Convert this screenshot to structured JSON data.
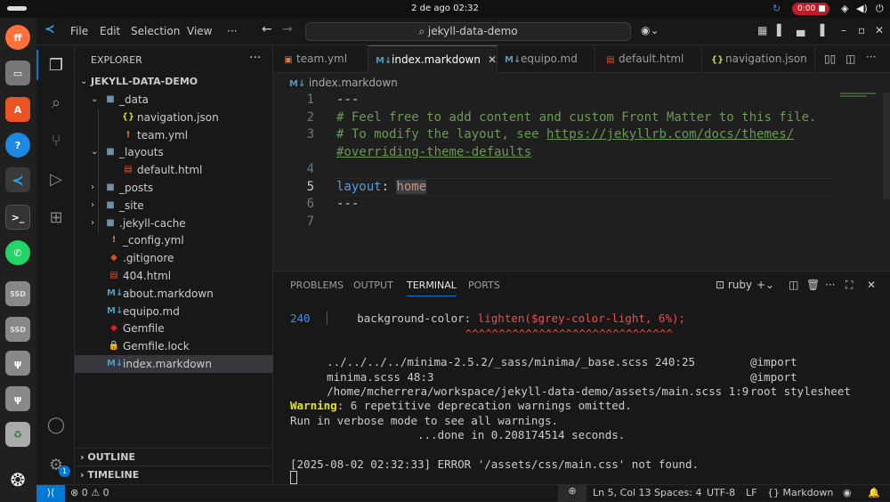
{
  "system": {
    "clock": "2 de ago  02:32",
    "recording": "0:00"
  },
  "dock": {
    "apps": [
      "firefox-icon",
      "files-icon",
      "app-center-icon",
      "help-icon",
      "vscode-icon",
      "terminal-icon",
      "whatsapp-icon",
      "drive-icon",
      "drive-icon",
      "usb-icon",
      "usb-icon",
      "trash-icon",
      "show-apps-icon"
    ],
    "ssd_label": "SSD"
  },
  "titlebar": {
    "menus": [
      "File",
      "Edit",
      "Selection",
      "View",
      "···"
    ],
    "search": "jekyll-data-demo"
  },
  "sidebar": {
    "title": "EXPLORER",
    "root": "JEKYLL-DATA-DEMO",
    "items": [
      {
        "label": "_data",
        "type": "folder",
        "open": true,
        "depth": 1
      },
      {
        "label": "navigation.json",
        "type": "json",
        "depth": 2
      },
      {
        "label": "team.yml",
        "type": "yml",
        "depth": 2
      },
      {
        "label": "_layouts",
        "type": "folder",
        "open": true,
        "depth": 1
      },
      {
        "label": "default.html",
        "type": "html",
        "depth": 2
      },
      {
        "label": "_posts",
        "type": "folder",
        "open": false,
        "depth": 1
      },
      {
        "label": "_site",
        "type": "folder",
        "open": false,
        "depth": 1
      },
      {
        "label": ".jekyll-cache",
        "type": "folder",
        "open": false,
        "depth": 1
      },
      {
        "label": "_config.yml",
        "type": "yml",
        "depth": 1
      },
      {
        "label": ".gitignore",
        "type": "git",
        "depth": 1
      },
      {
        "label": "404.html",
        "type": "html",
        "depth": 1
      },
      {
        "label": "about.markdown",
        "type": "md",
        "depth": 1
      },
      {
        "label": "equipo.md",
        "type": "md",
        "depth": 1
      },
      {
        "label": "Gemfile",
        "type": "gem",
        "depth": 1
      },
      {
        "label": "Gemfile.lock",
        "type": "lock",
        "depth": 1
      },
      {
        "label": "index.markdown",
        "type": "md",
        "depth": 1,
        "selected": true
      }
    ],
    "outline": "OUTLINE",
    "timeline": "TIMELINE"
  },
  "tabs": [
    {
      "label": "team.yml",
      "type": "yml"
    },
    {
      "label": "index.markdown",
      "type": "md",
      "active": true
    },
    {
      "label": "equipo.md",
      "type": "md"
    },
    {
      "label": "default.html",
      "type": "html"
    },
    {
      "label": "navigation.json",
      "type": "json"
    }
  ],
  "breadcrumb": "index.markdown",
  "editor": {
    "line_numbers": [
      "1",
      "2",
      "3",
      "",
      "4",
      "5",
      "6",
      "7"
    ],
    "line1": "---",
    "line2": "# Feel free to add content and custom Front Matter to this file.",
    "line3a": "# To modify the layout, see ",
    "line3b": "https://jekyllrb.com/docs/themes/",
    "line3c": "#overriding-theme-defaults",
    "line5key": "layout",
    "line5colon": ": ",
    "line5val": "home",
    "line6": "---"
  },
  "panel": {
    "tabs": [
      "PROBLEMS",
      "OUTPUT",
      "TERMINAL",
      "PORTS"
    ],
    "shell": "ruby",
    "terminal": {
      "l1num": "240",
      "l1a": "    background-color: ",
      "l1b": "lighten($grey-color-light, 6%);",
      "l2": "                      ^^^^^^^^^^^^^^^^^^^^^^^^^^^^^^^",
      "l3a": "    ../../../../minima-2.5.2/_sass/minima/_base.scss 240:25",
      "l3b": "@import",
      "l4a": "    minima.scss 48:3",
      "l4b": "@import",
      "l5a": "    /home/mcherrera/workspace/jekyll-data-demo/assets/main.scss 1:9",
      "l5b": "root stylesheet",
      "l6a": "Warning",
      "l6b": ": 6 repetitive deprecation warnings omitted.",
      "l7": "Run in verbose mode to see all warnings.",
      "l8": "                   ...done in 0.208174514 seconds.",
      "l9": "[2025-08-02 02:32:33] ERROR '/assets/css/main.css' not found."
    }
  },
  "status": {
    "errors": "0",
    "warnings": "0",
    "position": "Ln 5, Col 13",
    "spaces": "Spaces: 4",
    "encoding": "UTF-8",
    "eol": "LF",
    "language": "Markdown"
  },
  "colors": {
    "accent": "#0078d4",
    "yml": "#e37933",
    "md": "#519aba",
    "html": "#e34c26",
    "json": "#cbcb41",
    "gem": "#e51b24"
  }
}
